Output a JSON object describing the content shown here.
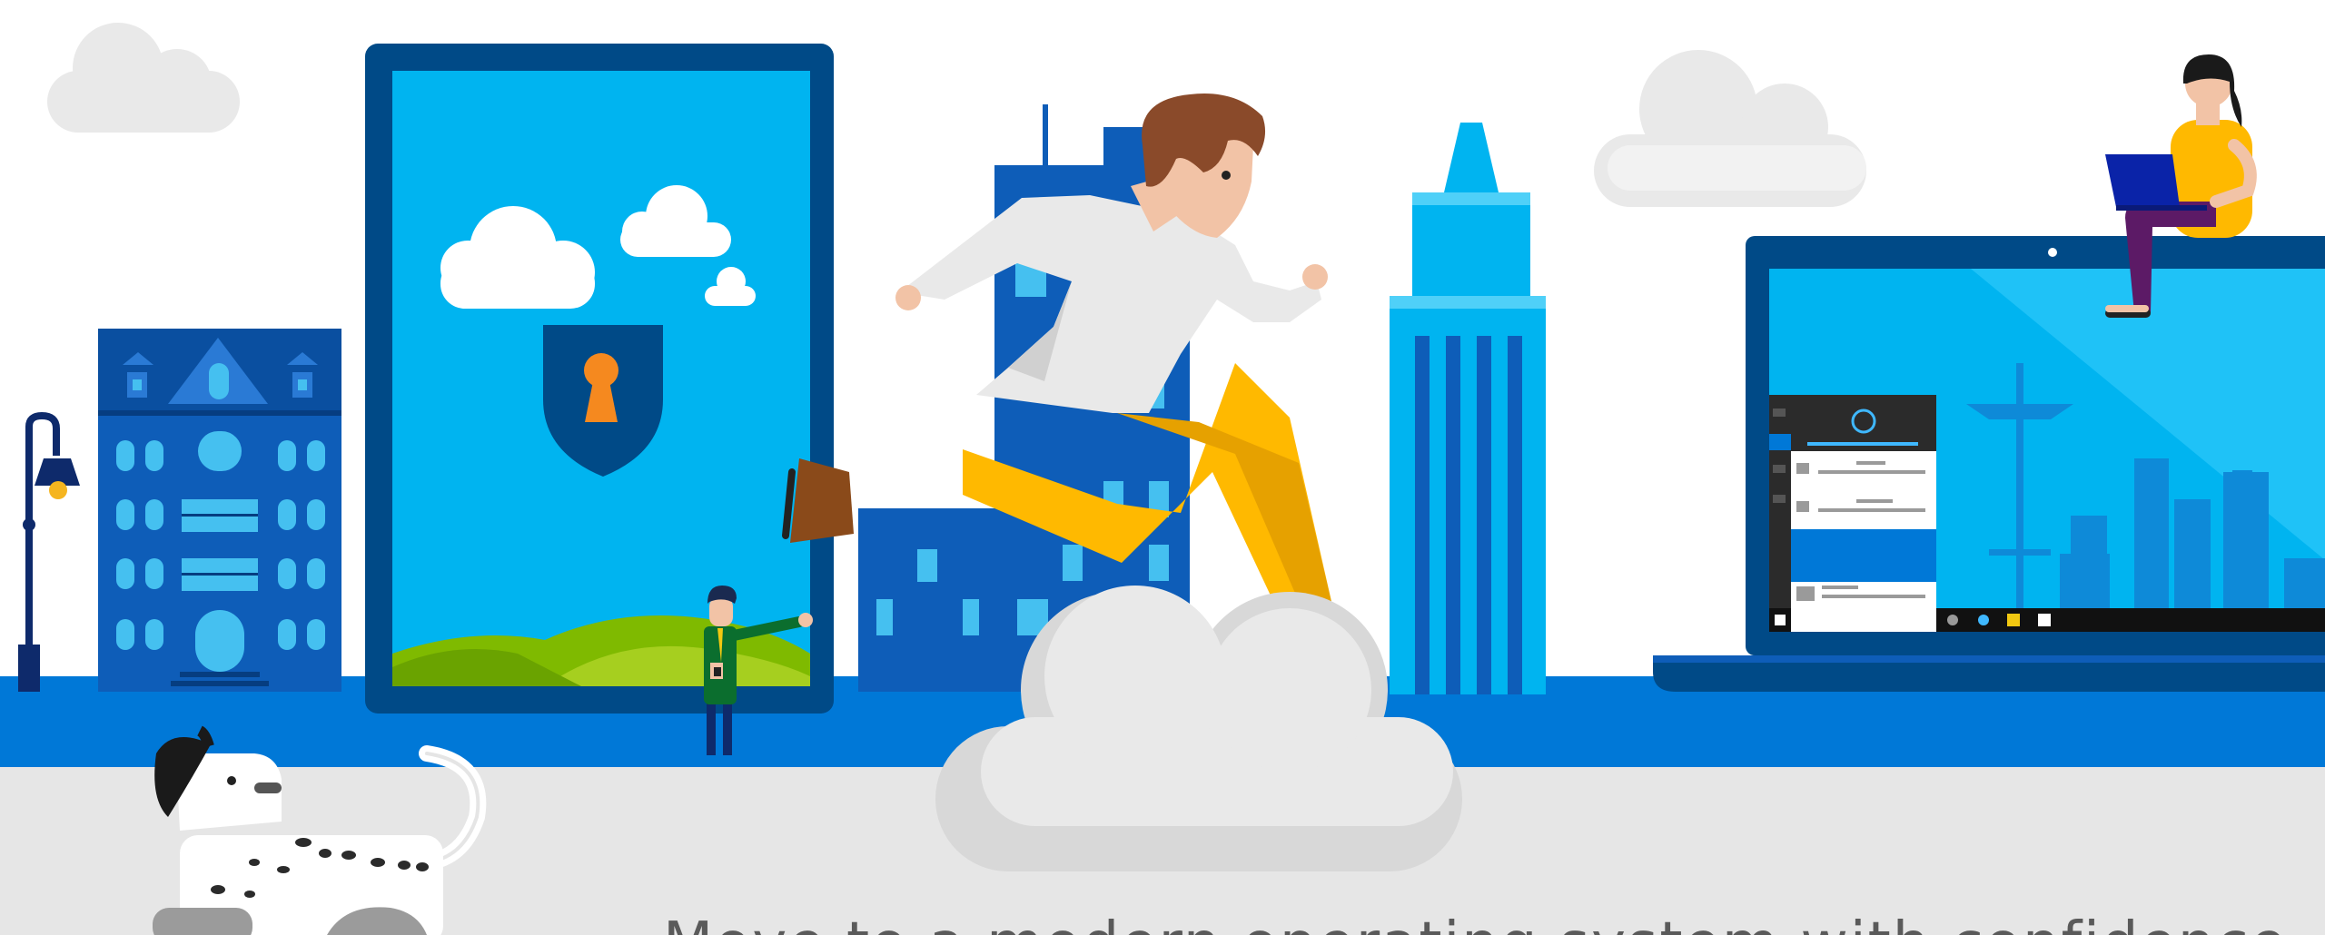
{
  "hero": {
    "caption": "Move to a modern operating system with confidence",
    "colors": {
      "sky": "#ffffff",
      "street_blue": "#0078d7",
      "sidewalk": "#e6e6e6",
      "screen_blue": "#00b4f0",
      "dark_blue": "#004a87",
      "accent_orange": "#f5891f",
      "pants_yellow": "#ffb900"
    },
    "figures": [
      "streetlamp",
      "blue-townhouse",
      "tablet-with-lock-shield",
      "man-with-phone",
      "running-man",
      "tall-blue-building",
      "spire-tower",
      "laptop-with-start-menu",
      "woman-with-laptop",
      "dalmatian-dog"
    ]
  }
}
